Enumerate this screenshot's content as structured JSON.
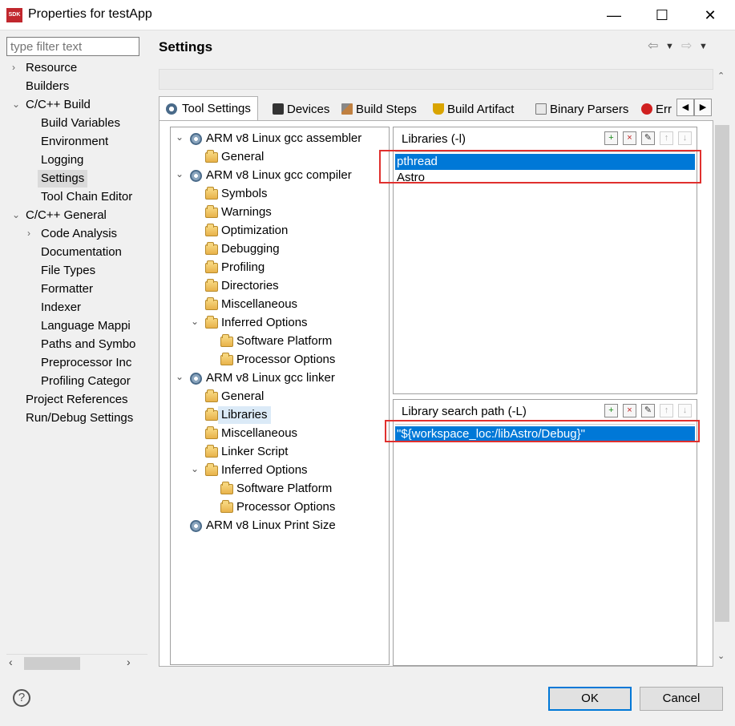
{
  "window": {
    "title": "Properties for testApp",
    "app_icon_text": "SDK",
    "minimize": "—",
    "maximize": "☐",
    "close": "✕"
  },
  "filter": {
    "placeholder": "type filter text"
  },
  "nav": {
    "items": [
      {
        "label": "Resource",
        "level": 0,
        "chevron": "›"
      },
      {
        "label": "Builders",
        "level": 0
      },
      {
        "label": "C/C++ Build",
        "level": 0,
        "chevron": "⌄"
      },
      {
        "label": "Build Variables",
        "level": 1
      },
      {
        "label": "Environment",
        "level": 1
      },
      {
        "label": "Logging",
        "level": 1
      },
      {
        "label": "Settings",
        "level": 1,
        "selected": true
      },
      {
        "label": "Tool Chain Editor",
        "level": 1
      },
      {
        "label": "C/C++ General",
        "level": 0,
        "chevron": "⌄"
      },
      {
        "label": "Code Analysis",
        "level": 1,
        "chevron": "›"
      },
      {
        "label": "Documentation",
        "level": 1
      },
      {
        "label": "File Types",
        "level": 1
      },
      {
        "label": "Formatter",
        "level": 1
      },
      {
        "label": "Indexer",
        "level": 1
      },
      {
        "label": "Language Mappi",
        "level": 1
      },
      {
        "label": "Paths and Symbo",
        "level": 1
      },
      {
        "label": "Preprocessor Inc",
        "level": 1
      },
      {
        "label": "Profiling Categor",
        "level": 1
      },
      {
        "label": "Project References",
        "level": 0
      },
      {
        "label": "Run/Debug Settings",
        "level": 0
      }
    ]
  },
  "page": {
    "title": "Settings"
  },
  "tabs": [
    {
      "label": "Tool Settings",
      "active": true
    },
    {
      "label": "Devices"
    },
    {
      "label": "Build Steps"
    },
    {
      "label": "Build Artifact"
    },
    {
      "label": "Binary Parsers"
    },
    {
      "label": "Err"
    }
  ],
  "tool_tree": [
    {
      "label": "ARM v8 Linux gcc assembler",
      "level": 0,
      "icon": "gear",
      "chevron": "⌄"
    },
    {
      "label": "General",
      "level": 1,
      "icon": "folder"
    },
    {
      "label": "ARM v8 Linux gcc compiler",
      "level": 0,
      "icon": "gear",
      "chevron": "⌄"
    },
    {
      "label": "Symbols",
      "level": 1,
      "icon": "folder"
    },
    {
      "label": "Warnings",
      "level": 1,
      "icon": "folder"
    },
    {
      "label": "Optimization",
      "level": 1,
      "icon": "folder"
    },
    {
      "label": "Debugging",
      "level": 1,
      "icon": "folder"
    },
    {
      "label": "Profiling",
      "level": 1,
      "icon": "folder"
    },
    {
      "label": "Directories",
      "level": 1,
      "icon": "folder"
    },
    {
      "label": "Miscellaneous",
      "level": 1,
      "icon": "folder"
    },
    {
      "label": "Inferred Options",
      "level": 1,
      "icon": "folder",
      "chevron": "⌄"
    },
    {
      "label": "Software Platform",
      "level": 2,
      "icon": "folder"
    },
    {
      "label": "Processor Options",
      "level": 2,
      "icon": "folder"
    },
    {
      "label": "ARM v8 Linux gcc linker",
      "level": 0,
      "icon": "gear",
      "chevron": "⌄"
    },
    {
      "label": "General",
      "level": 1,
      "icon": "folder"
    },
    {
      "label": "Libraries",
      "level": 1,
      "icon": "folder",
      "selected": true
    },
    {
      "label": "Miscellaneous",
      "level": 1,
      "icon": "folder"
    },
    {
      "label": "Linker Script",
      "level": 1,
      "icon": "folder"
    },
    {
      "label": "Inferred Options",
      "level": 1,
      "icon": "folder",
      "chevron": "⌄"
    },
    {
      "label": "Software Platform",
      "level": 2,
      "icon": "folder"
    },
    {
      "label": "Processor Options",
      "level": 2,
      "icon": "folder"
    },
    {
      "label": "ARM v8 Linux Print Size",
      "level": 0,
      "icon": "gear"
    }
  ],
  "libraries": {
    "title": "Libraries (-l)",
    "items": [
      {
        "value": "pthread",
        "selected": true
      },
      {
        "value": "Astro"
      }
    ]
  },
  "library_paths": {
    "title": "Library search path (-L)",
    "items": [
      {
        "value": "\"${workspace_loc:/libAstro/Debug}\"",
        "selected": true
      }
    ]
  },
  "list_tools": [
    {
      "name": "add-icon",
      "glyph": "+"
    },
    {
      "name": "delete-icon",
      "glyph": "×"
    },
    {
      "name": "edit-icon",
      "glyph": "✎"
    },
    {
      "name": "move-up-icon",
      "glyph": "↑"
    },
    {
      "name": "move-down-icon",
      "glyph": "↓"
    }
  ],
  "buttons": {
    "ok": "OK",
    "cancel": "Cancel",
    "help": "?"
  },
  "colors": {
    "selection": "#0078d7",
    "highlight_box": "#e0302e",
    "nav_selected": "#dadada"
  }
}
